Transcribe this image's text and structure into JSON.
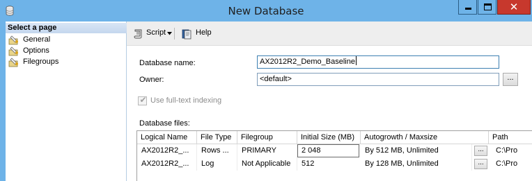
{
  "window": {
    "title": "New Database",
    "close_glyph": "✕"
  },
  "left_panel": {
    "header": "Select a page",
    "items": [
      {
        "label": "General",
        "icon": "page-icon"
      },
      {
        "label": "Options",
        "icon": "page-icon"
      },
      {
        "label": "Filegroups",
        "icon": "page-icon"
      }
    ]
  },
  "toolbar": {
    "script_label": "Script",
    "help_label": "Help"
  },
  "form": {
    "db_name_label": "Database name:",
    "db_name_value": "AX2012R2_Demo_Baseline",
    "owner_label": "Owner:",
    "owner_value": "<default>",
    "browse_label": "...",
    "fulltext_label": "Use full-text indexing",
    "fulltext_checked": true,
    "files_label": "Database files:"
  },
  "files_table": {
    "columns": [
      "Logical Name",
      "File Type",
      "Filegroup",
      "Initial Size (MB)",
      "Autogrowth / Maxsize",
      "Path"
    ],
    "rows": [
      {
        "logical_name": "AX2012R2_...",
        "file_type": "Rows ...",
        "filegroup": "PRIMARY",
        "initial_size": "2 048",
        "autogrowth": "By 512 MB, Unlimited",
        "button": "...",
        "path": "C:\\Pro"
      },
      {
        "logical_name": "AX2012R2_...",
        "file_type": "Log",
        "filegroup": "Not Applicable",
        "initial_size": "512",
        "autogrowth": "By 128 MB, Unlimited",
        "button": "...",
        "path": "C:\\Pro"
      }
    ]
  },
  "colors": {
    "title_bar": "#6eb3e8",
    "close_button": "#c7382d"
  }
}
